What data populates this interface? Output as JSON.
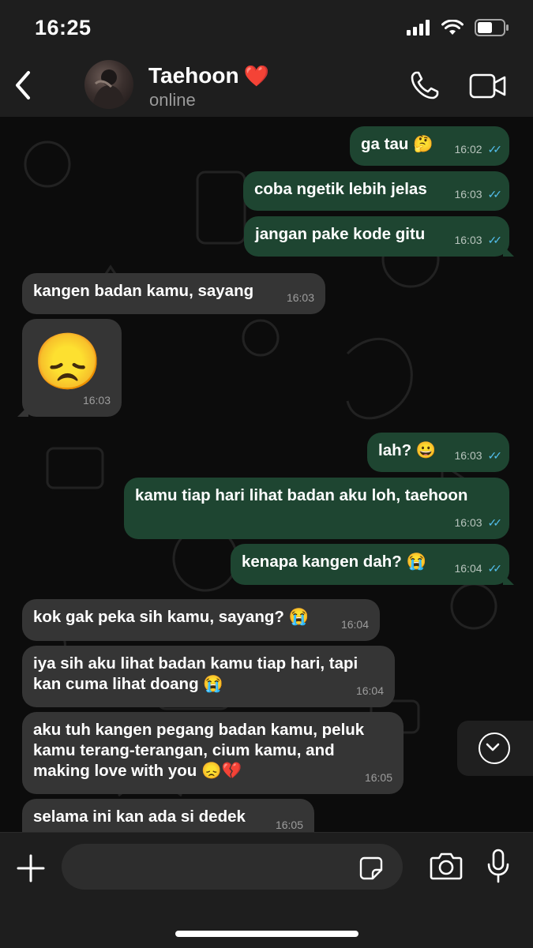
{
  "status": {
    "time": "16:25"
  },
  "header": {
    "name": "Taehoon",
    "heart": "❤️",
    "status": "online"
  },
  "messages": [
    {
      "dir": "out",
      "text": "ga tau 🤔",
      "time": "16:02",
      "read": true
    },
    {
      "dir": "out",
      "text": "coba ngetik lebih jelas",
      "time": "16:03",
      "read": true
    },
    {
      "dir": "out",
      "text": "jangan pake kode gitu",
      "time": "16:03",
      "read": true
    },
    {
      "dir": "in",
      "text": "kangen badan kamu, sayang",
      "time": "16:03"
    },
    {
      "dir": "in",
      "text": "😞",
      "time": "16:03"
    },
    {
      "dir": "out",
      "text": "lah? 😀",
      "time": "16:03",
      "read": true
    },
    {
      "dir": "out",
      "text": "kamu tiap hari lihat badan aku loh, taehoon",
      "time": "16:03",
      "read": true
    },
    {
      "dir": "out",
      "text": "kenapa kangen dah? 😭",
      "time": "16:04",
      "read": true
    },
    {
      "dir": "in",
      "text": "kok gak peka sih kamu, sayang? 😭",
      "time": "16:04"
    },
    {
      "dir": "in",
      "text": "iya sih aku lihat badan kamu tiap hari, tapi kan cuma lihat doang 😭",
      "time": "16:04"
    },
    {
      "dir": "in",
      "text": "aku tuh kangen pegang badan kamu, peluk kamu terang-terangan, cium kamu, and making love with you 😞💔",
      "time": "16:05"
    },
    {
      "dir": "in",
      "text": "selama ini kan ada si dedek",
      "time": "16:05"
    }
  ],
  "composer": {
    "placeholder": ""
  },
  "colors": {
    "outgoing": "#1e4531",
    "incoming": "#353535",
    "read_ticks": "#53bdeb",
    "header": "#1e1e1e"
  },
  "icons": [
    "back-chevron-icon",
    "phone-icon",
    "video-camera-icon",
    "scroll-down-icon",
    "plus-icon",
    "sticker-icon",
    "camera-icon",
    "microphone-icon",
    "signal-icon",
    "wifi-icon",
    "battery-icon"
  ]
}
